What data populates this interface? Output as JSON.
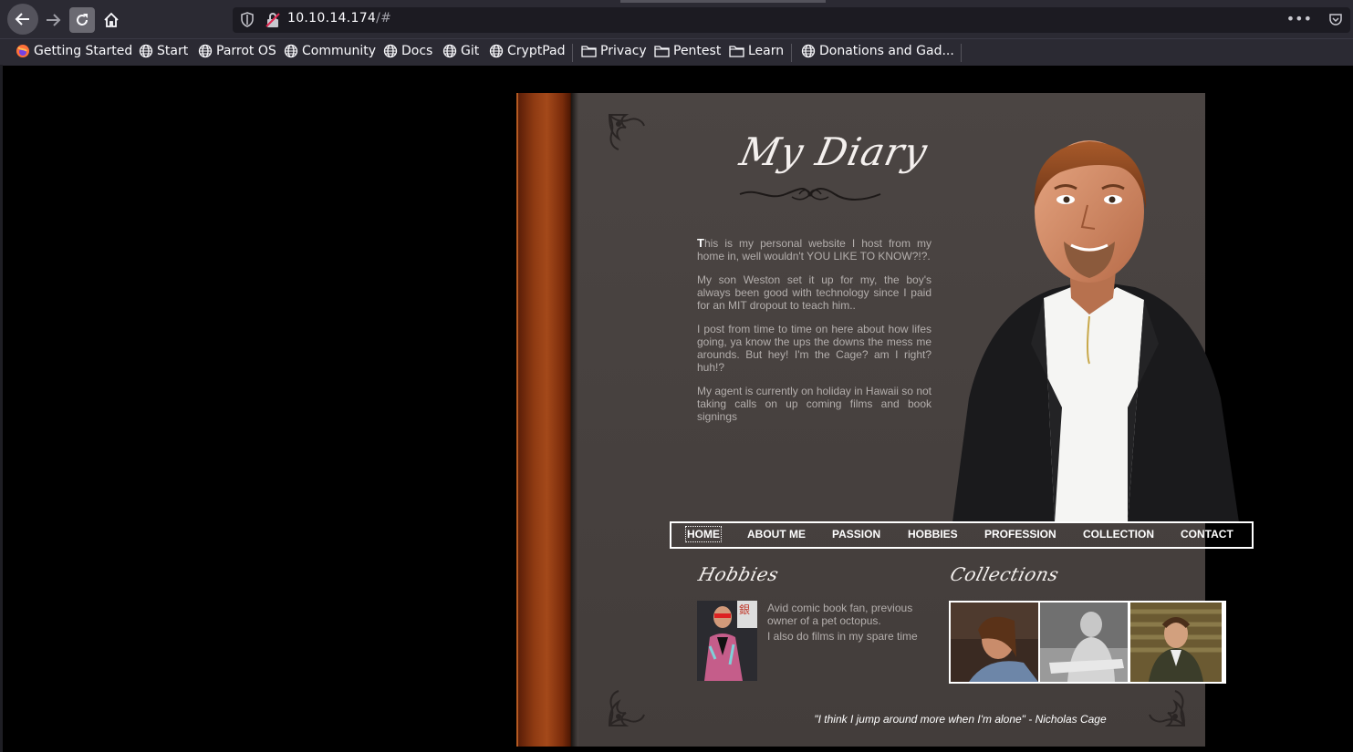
{
  "browser": {
    "url_host": "10.10.14.174",
    "url_path": "/#",
    "bookmarks": [
      {
        "label": "Getting Started",
        "icon": "firefox-icon"
      },
      {
        "label": "Start",
        "icon": "globe-icon"
      },
      {
        "label": "Parrot OS",
        "icon": "globe-icon"
      },
      {
        "label": "Community",
        "icon": "globe-icon"
      },
      {
        "label": "Docs",
        "icon": "globe-icon"
      },
      {
        "label": "Git",
        "icon": "globe-icon"
      },
      {
        "label": "CryptPad",
        "icon": "globe-icon"
      },
      {
        "label": "Privacy",
        "icon": "folder-icon"
      },
      {
        "label": "Pentest",
        "icon": "folder-icon"
      },
      {
        "label": "Learn",
        "icon": "folder-icon"
      },
      {
        "label": "Donations and Gad...",
        "icon": "globe-icon"
      }
    ]
  },
  "site": {
    "title": "My Diary",
    "intro": {
      "drop_cap": "T",
      "p1_rest": "his is my personal website I host from my home in, well wouldn't YOU LIKE TO KNOW?!?.",
      "p2": "My son Weston set it up for my, the boy's always been good with technology since I paid for an MIT dropout to teach him..",
      "p3": "I post from time to time on here about how lifes going, ya know the ups the downs the mess me arounds. But hey! I'm the Cage? am I right? huh!?",
      "p4": "My agent is currently on holiday in Hawaii so not taking calls on up coming films and book signings"
    },
    "nav": [
      "HOME",
      "ABOUT ME",
      "PASSION",
      "HOBBIES",
      "PROFESSION",
      "COLLECTION",
      "CONTACT"
    ],
    "hobbies": {
      "title": "Hobbies",
      "line1": "Avid comic book fan, previous owner of a pet octopus.",
      "line2": "I also do films in my spare time"
    },
    "collections": {
      "title": "Collections"
    },
    "quote": "\"I think I jump around more when I'm alone\" - Nicholas Cage"
  },
  "colors": {
    "page_bg": "#46403e",
    "spine": "#8e3a12",
    "text": "#b3aeac",
    "browser_bg": "#2b2a33"
  }
}
